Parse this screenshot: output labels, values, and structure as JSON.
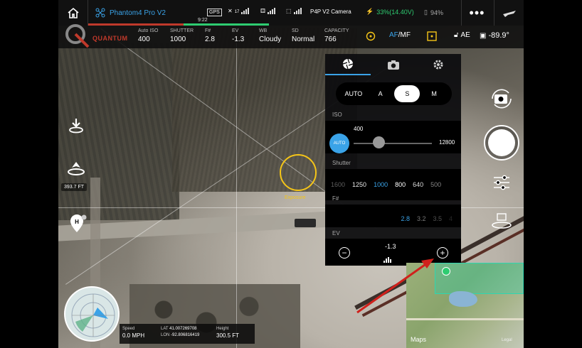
{
  "topbar": {
    "aircraft_name": "Phantom4 Pro V2",
    "flight_time": "9:22",
    "gps_label": "GPS",
    "gps_satellites": "17",
    "camera_name": "P4P V2 Camera",
    "battery_status": "33%(14.40V)",
    "device_battery": "94%"
  },
  "params": {
    "brand": "QUANTUM",
    "iso": {
      "label": "Auto ISO",
      "value": "400"
    },
    "shutter": {
      "label": "SHUTTER",
      "value": "1000"
    },
    "fnum": {
      "label": "F#",
      "value": "2.8"
    },
    "ev": {
      "label": "EV",
      "value": "-1.3"
    },
    "wb": {
      "label": "WB",
      "value": "Cloudy"
    },
    "sd": {
      "label": "SD",
      "value": "Normal"
    },
    "capacity": {
      "label": "CAPACITY",
      "value": "766"
    },
    "focus_af": "AF",
    "focus_mf": "/MF",
    "ae_lock": "AE",
    "gimbal_angle": "-89.9°"
  },
  "left": {
    "distance": "393.7 FT"
  },
  "exposure": {
    "label": "Exposure"
  },
  "panel": {
    "modes": [
      "AUTO",
      "A",
      "S",
      "M"
    ],
    "selected_mode": "S",
    "iso_label": "ISO",
    "iso_auto": "AUTO",
    "iso_value": "400",
    "iso_max": "12800",
    "shutter_label": "Shutter",
    "shutter_values": [
      "1600",
      "1250",
      "1000",
      "800",
      "640",
      "500"
    ],
    "shutter_selected": "1000",
    "fnum_label": "F#",
    "fnum_values": [
      "2.8",
      "3.2",
      "3.5",
      "4"
    ],
    "fnum_selected": "2.8",
    "ev_label": "EV",
    "ev_value": "-1.3",
    "ev_minus": "−",
    "ev_plus": "+"
  },
  "map": {
    "provider": "Maps",
    "legal": "Legal"
  },
  "telemetry": {
    "speed_label": "Speed",
    "speed_value": "0.0 MPH",
    "lat_label": "LAT",
    "lat_value": "41.007269708",
    "lon_label": "LON",
    "lon_value": "-92.806816419",
    "height_label": "Height",
    "height_value": "300.5 FT"
  },
  "colors": {
    "accent_blue": "#3aa3e8",
    "battery_green": "#2ecc71",
    "exposure_yellow": "#f5c518",
    "arrow_red": "#d0211c"
  }
}
